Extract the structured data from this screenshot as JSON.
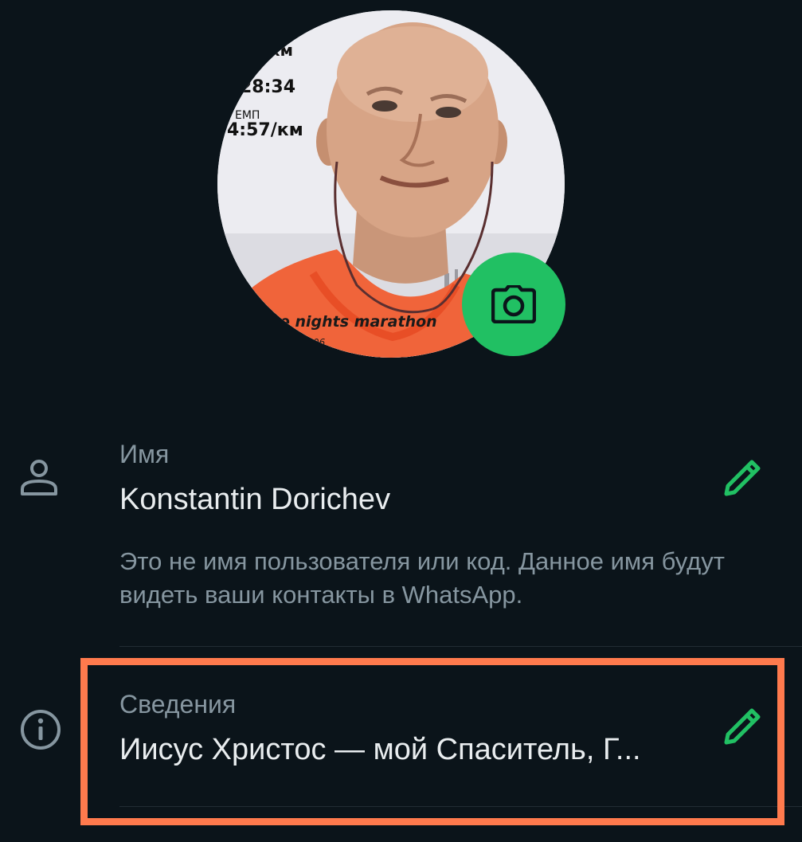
{
  "profile": {
    "photo_overlay": {
      "line1": "км",
      "line2": "28:34",
      "line3": "ЕМП",
      "line4": "4:57/км",
      "caption": "e nights marathon",
      "caption_sub": "06"
    }
  },
  "name_field": {
    "label": "Имя",
    "value": "Konstantin Dorichev",
    "hint": "Это не имя пользователя или код. Данное имя будут видеть ваши контакты в WhatsApp."
  },
  "about_field": {
    "label": "Сведения",
    "value": "Иисус Христос — мой Спаситель, Г..."
  },
  "icons": {
    "camera": "camera-icon",
    "person": "person-icon",
    "info": "info-icon",
    "edit": "pencil-icon"
  },
  "colors": {
    "background": "#0b141a",
    "accent": "#21c063",
    "highlight": "#ff7a4d",
    "text_primary": "#e9edef",
    "text_secondary": "#8696a0"
  }
}
